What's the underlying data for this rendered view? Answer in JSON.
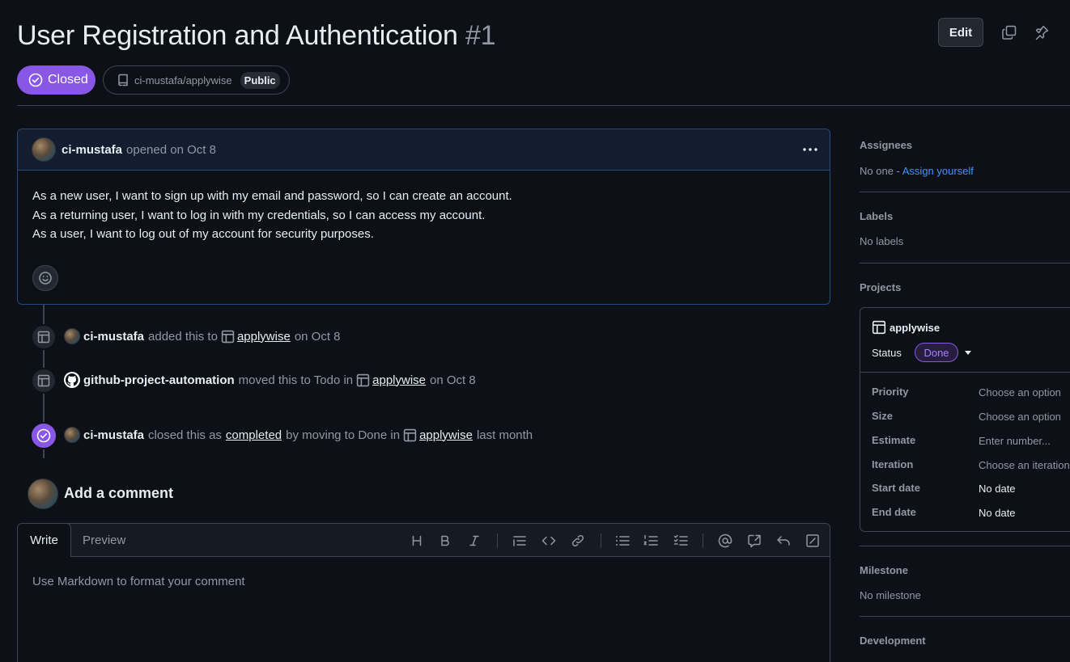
{
  "header": {
    "title": "User Registration and Authentication",
    "number": "#1",
    "edit_label": "Edit",
    "state_label": "Closed",
    "repo_name": "ci-mustafa/applywise",
    "repo_visibility": "Public"
  },
  "comment": {
    "author": "ci-mustafa",
    "meta": "opened on Oct 8",
    "body": [
      "As a new user, I want to sign up with my email and password, so I can create an account.",
      "As a returning user, I want to log in with my credentials, so I can access my account.",
      "As a user, I want to log out of my account for security purposes."
    ]
  },
  "timeline": [
    {
      "actor": "ci-mustafa",
      "pre": "added this to",
      "project": "applywise",
      "post": "on Oct 8"
    },
    {
      "actor": "github-project-automation",
      "pre": "moved this to Todo in",
      "project": "applywise",
      "post": "on Oct 8"
    },
    {
      "actor": "ci-mustafa",
      "pre": "closed this as",
      "link": "completed",
      "mid": "by moving to Done in",
      "project": "applywise",
      "post": "last month"
    }
  ],
  "add_comment": {
    "title": "Add a comment",
    "tab_write": "Write",
    "tab_preview": "Preview",
    "placeholder": "Use Markdown to format your comment"
  },
  "sidebar": {
    "assignees_label": "Assignees",
    "assignees_value": "No one - ",
    "assign_link": "Assign yourself",
    "labels_label": "Labels",
    "labels_value": "No labels",
    "projects_label": "Projects",
    "project": {
      "name": "applywise",
      "status_label": "Status",
      "status_value": "Done",
      "fields": [
        {
          "label": "Priority",
          "value": "Choose an option"
        },
        {
          "label": "Size",
          "value": "Choose an option"
        },
        {
          "label": "Estimate",
          "value": "Enter number..."
        },
        {
          "label": "Iteration",
          "value": "Choose an iteration"
        },
        {
          "label": "Start date",
          "value": "No date"
        },
        {
          "label": "End date",
          "value": "No date"
        }
      ]
    },
    "milestone_label": "Milestone",
    "milestone_value": "No milestone",
    "development_label": "Development"
  },
  "colors": {
    "closed_purple": "#8957e5",
    "link_blue": "#4493f8",
    "bg": "#0d1117"
  }
}
